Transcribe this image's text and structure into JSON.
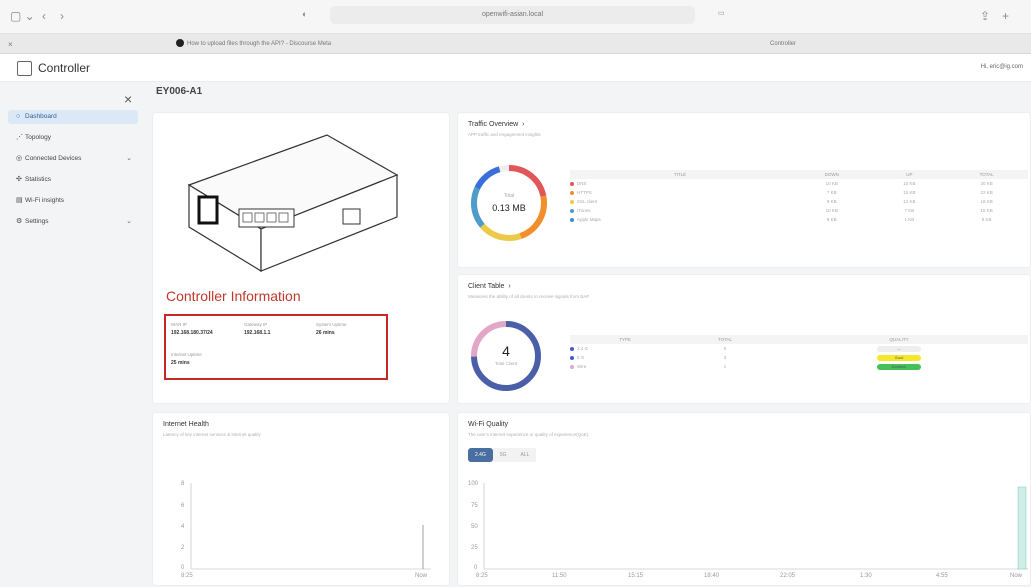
{
  "browser": {
    "url": "openwifi-asian.local",
    "tabs": [
      "How to upload files through the API? - Discourse Meta",
      "Controller"
    ]
  },
  "app": {
    "brand": "Controller",
    "user": "Hi, eric@ig.com",
    "page_title": "EY006-A1"
  },
  "sidebar": {
    "items": [
      {
        "label": "Dashboard",
        "icon": "circle-icon",
        "active": true,
        "chevron": false
      },
      {
        "label": "Topology",
        "icon": "topology-icon",
        "active": false,
        "chevron": false
      },
      {
        "label": "Connected Devices",
        "icon": "devices-icon",
        "active": false,
        "chevron": true
      },
      {
        "label": "Statistics",
        "icon": "statistics-icon",
        "active": false,
        "chevron": false
      },
      {
        "label": "Wi-Fi insights",
        "icon": "wifi-insights-icon",
        "active": false,
        "chevron": false
      },
      {
        "label": "Settings",
        "icon": "gear-icon",
        "active": false,
        "chevron": true
      }
    ]
  },
  "controller": {
    "title": "Controller Information",
    "fields": [
      {
        "label": "WAN IP",
        "value": "192.168.180.37/24"
      },
      {
        "label": "Gateway IP",
        "value": "192.168.1.1"
      },
      {
        "label": "System Uptime",
        "value": "26 mins"
      },
      {
        "label": "Internet Uptime",
        "value": "25 mins"
      }
    ]
  },
  "traffic": {
    "title": "Traffic Overview",
    "subtitle": "APP traffic and engagement insights",
    "donut_label": "Total",
    "donut_value": "0.13 MB",
    "columns": [
      "TITLE",
      "DOWN",
      "UP",
      "TOTAL"
    ],
    "rows": [
      {
        "title": "DNS",
        "color": "#e15759",
        "down": "10 KB",
        "up": "10 KB",
        "total": "20 KB"
      },
      {
        "title": "HTTPS",
        "color": "#f28e2b",
        "down": "7 KB",
        "up": "15 KB",
        "total": "22 KB"
      },
      {
        "title": "SSL client",
        "color": "#edc948",
        "down": "8 KB",
        "up": "12 KB",
        "total": "18 KB"
      },
      {
        "title": "iTunes",
        "color": "#4e9cc9",
        "down": "10 KB",
        "up": "7 KB",
        "total": "15 KB"
      },
      {
        "title": "Apple Maps",
        "color": "#3a8fd9",
        "down": "8 KB",
        "up": "1 KB",
        "total": "9 KB"
      }
    ]
  },
  "clients": {
    "title": "Client Table",
    "subtitle": "Measures the ability of all clients to receive signals from BAP",
    "donut_value": "4",
    "donut_label": "Total Client",
    "columns": [
      "TYPE",
      "TOTAL",
      "QUALITY"
    ],
    "rows": [
      {
        "type": "2.4 G",
        "color": "#3b5bdb",
        "total": "0",
        "quality": "---",
        "badge_color": "#eeeeee"
      },
      {
        "type": "5 G",
        "color": "#3b5bdb",
        "total": "3",
        "quality": "Good",
        "badge_color": "#f5e82a"
      },
      {
        "type": "Wire",
        "color": "#e2a6c8",
        "total": "1",
        "quality": "Excellent",
        "badge_color": "#46c15a"
      }
    ]
  },
  "internet_health": {
    "title": "Internet Health",
    "subtitle": "Latency of key internet services & internet quality",
    "y_ticks": [
      "8",
      "6",
      "4",
      "2",
      "0"
    ],
    "x_ticks": [
      "8:25",
      "Now"
    ]
  },
  "wifi_quality": {
    "title": "Wi-Fi Quality",
    "subtitle": "The user's internet experience or quality of experience(QoE)",
    "tabs": [
      "2.4G",
      "5G",
      "ALL"
    ],
    "y_ticks": [
      "100",
      "75",
      "50",
      "25",
      "0"
    ],
    "x_ticks": [
      "8:25",
      "11:50",
      "15:15",
      "18:40",
      "22:05",
      "1:30",
      "4:55",
      "Now"
    ]
  }
}
